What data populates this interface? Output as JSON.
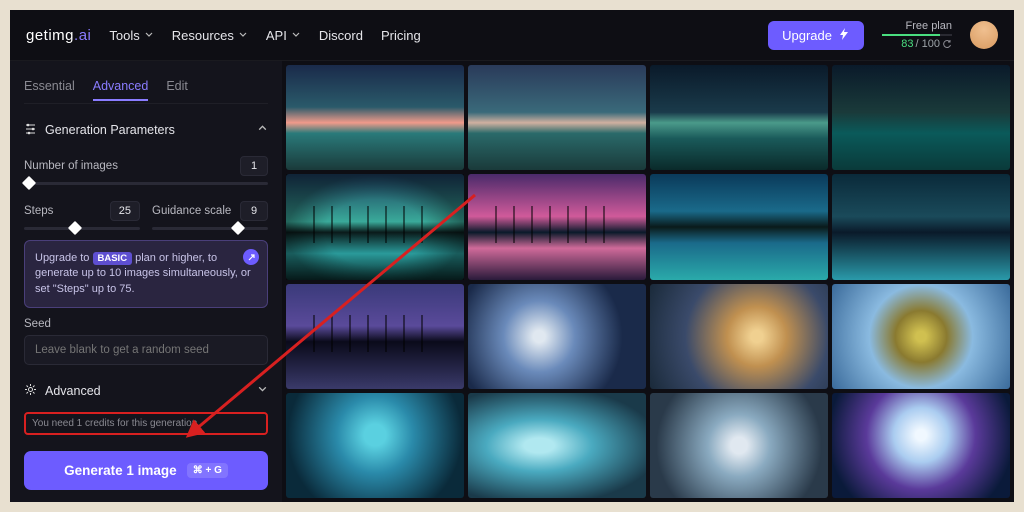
{
  "brand": {
    "name": "getimg",
    "suffix": "ai"
  },
  "nav": {
    "tools": "Tools",
    "resources": "Resources",
    "api": "API",
    "discord": "Discord",
    "pricing": "Pricing"
  },
  "header": {
    "upgrade": "Upgrade",
    "plan": "Free plan",
    "credits_used": "83",
    "credits_total": "/ 100"
  },
  "sidebar": {
    "tabs": {
      "essential": "Essential",
      "advanced": "Advanced",
      "edit": "Edit"
    },
    "generation_params": "Generation Parameters",
    "num_images_label": "Number of images",
    "num_images_value": "1",
    "steps_label": "Steps",
    "steps_value": "25",
    "guidance_label": "Guidance scale",
    "guidance_value": "9",
    "upsell_prefix": "Upgrade to",
    "upsell_badge": "BASIC",
    "upsell_suffix": "plan or higher, to generate up to 10 images simultaneously, or set \"Steps\" up to 75.",
    "seed_label": "Seed",
    "seed_placeholder": "Leave blank to get a random seed",
    "advanced": "Advanced",
    "credits_note": "You need 1 credits for this generation.",
    "generate": "Generate 1 image",
    "shortcut": "⌘ + G"
  }
}
